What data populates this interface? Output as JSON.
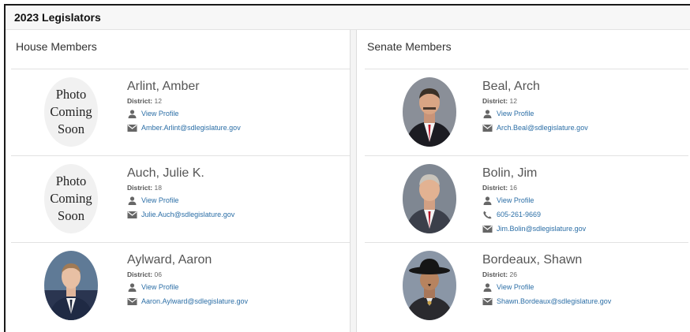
{
  "page": {
    "title": "2023 Legislators"
  },
  "house": {
    "heading": "House Members",
    "members": [
      {
        "name": "Arlint, Amber",
        "district_label": "District:",
        "district": "12",
        "profile_label": "View Profile",
        "email": "Amber.Arlint@sdlegislature.gov",
        "photo": "placeholder",
        "photo_text": [
          "Photo",
          "Coming",
          "Soon"
        ]
      },
      {
        "name": "Auch, Julie K.",
        "district_label": "District:",
        "district": "18",
        "profile_label": "View Profile",
        "email": "Julie.Auch@sdlegislature.gov",
        "photo": "placeholder",
        "photo_text": [
          "Photo",
          "Coming",
          "Soon"
        ]
      },
      {
        "name": "Aylward, Aaron",
        "district_label": "District:",
        "district": "06",
        "profile_label": "View Profile",
        "email": "Aaron.Aylward@sdlegislature.gov",
        "photo": "portrait"
      }
    ]
  },
  "senate": {
    "heading": "Senate Members",
    "members": [
      {
        "name": "Beal, Arch",
        "district_label": "District:",
        "district": "12",
        "profile_label": "View Profile",
        "email": "Arch.Beal@sdlegislature.gov",
        "photo": "portrait"
      },
      {
        "name": "Bolin, Jim",
        "district_label": "District:",
        "district": "16",
        "profile_label": "View Profile",
        "phone": "605-261-9669",
        "email": "Jim.Bolin@sdlegislature.gov",
        "photo": "portrait"
      },
      {
        "name": "Bordeaux, Shawn",
        "district_label": "District:",
        "district": "26",
        "profile_label": "View Profile",
        "email": "Shawn.Bordeaux@sdlegislature.gov",
        "photo": "portrait-hat"
      }
    ]
  },
  "icons": {
    "profile": "person-icon",
    "email": "envelope-icon",
    "phone": "phone-icon"
  },
  "colors": {
    "link": "#2b6ea6",
    "name": "#555555",
    "header_bg": "#f7f7f7",
    "border": "#e2e2e2"
  }
}
